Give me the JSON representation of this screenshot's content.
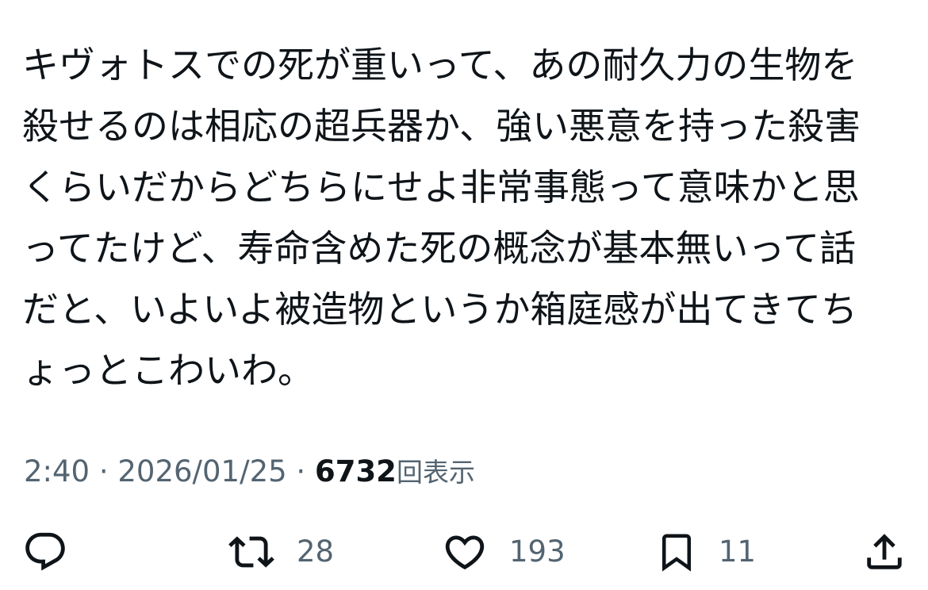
{
  "tweet": {
    "text_lines": [
      "キヴォトスでの死が重いって、あの耐久力の生物を",
      "殺せるのは相応の超兵器か、強い悪意を持った殺害",
      "くらいだからどちらにせよ非常事態って意味かと思",
      "ってたけど、寿命含めた死の概念が基本無いって話",
      "だと、いよいよ被造物というか箱庭感が出てきてち",
      "ょっとこわいわ。"
    ]
  },
  "meta": {
    "time": "2:40",
    "separator": "·",
    "date": "2026/01/25",
    "views_count": "6732",
    "views_label": "回表示"
  },
  "actions": {
    "reply_icon": "speech-bubble-icon",
    "retweet_icon": "retweet-arrows-icon",
    "retweet_count": "28",
    "like_icon": "heart-icon",
    "like_count": "193",
    "bookmark_icon": "bookmark-icon",
    "bookmark_count": "11",
    "share_icon": "share-upload-icon"
  },
  "colors": {
    "text": "#0f1419",
    "secondary": "#536471",
    "background": "#ffffff"
  }
}
